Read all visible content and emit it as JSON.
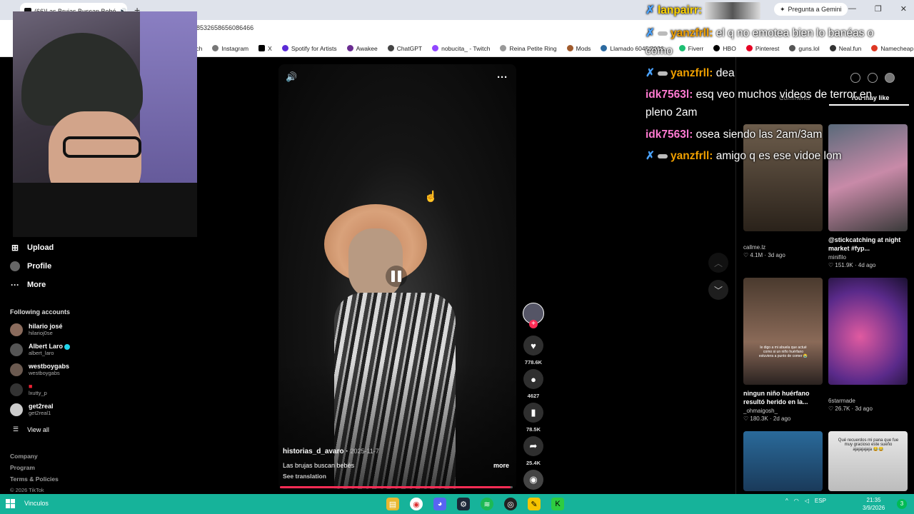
{
  "browser": {
    "tab_title": "(66)Las Brujas Buscan Bebé",
    "url_tail": "98532658656086466",
    "gemini_label": "Pregunta a Gemini",
    "bookmarks": [
      "tch",
      "Instagram",
      "X",
      "Spotify for Artists",
      "Awakee",
      "ChatGPT",
      "nobucita_ - Twitch",
      "Reina Petite Ring",
      "Mods",
      "Llamado 6045/2026...",
      "Fiverr",
      "HBO",
      "Pinterest",
      "guns.lol",
      "Neal.fun",
      "Namecheap"
    ]
  },
  "leftnav": {
    "upload": "Upload",
    "profile": "Profile",
    "more": "More",
    "following_title": "Following accounts",
    "accounts": [
      {
        "name": "hilario josé",
        "handle": "hilarioj0se"
      },
      {
        "name": "Albert Laro",
        "handle": "albert_laro"
      },
      {
        "name": "westboygabs",
        "handle": "westboygabs"
      },
      {
        "name": "",
        "handle": "lxutty_p"
      },
      {
        "name": "get2real",
        "handle": "get2real1"
      }
    ],
    "view_all": "View all",
    "footer": [
      "Company",
      "Program",
      "Terms & Policies",
      "© 2026 TikTok"
    ]
  },
  "video": {
    "author": "historias_d_avaro",
    "date": "2025-11-7",
    "caption": "Las brujas buscan bebés",
    "translate": "See translation",
    "more": "more",
    "progress": 0.99,
    "likes": "778.6K",
    "comments": "4627",
    "saves": "78.5K",
    "shares": "25.4K"
  },
  "chat": [
    {
      "user": "lanpairr",
      "text": "",
      "color": "#ffd400"
    },
    {
      "user": "yanzfrll",
      "text": "el q no emotea bien lo banéas o como",
      "color": "#f0a000"
    },
    {
      "user": "yanzfrll",
      "text": "dea",
      "color": "#f0a000"
    },
    {
      "user": "idk7563l",
      "text": "esq veo muchos videos de terror en pleno 2am",
      "color": "#ff7ad1"
    },
    {
      "user": "idk7563l",
      "text": "osea siendo las 2am/3am",
      "color": "#ff7ad1"
    },
    {
      "user": "yanzfrll",
      "text": "amigo q es ese vidoe lom",
      "color": "#f0a000"
    }
  ],
  "right_panel": {
    "tabs": [
      "Comments",
      "You may like"
    ],
    "cards": [
      {
        "title": "",
        "user": "callme.lz",
        "likes": "4.1M",
        "age": "3d ago"
      },
      {
        "title": "@stickcatching at night market #fyp...",
        "user": "minifilo",
        "likes": "151.9K",
        "age": "4d ago"
      },
      {
        "title": "ningun niño huérfano resultó herido en la...",
        "user": "_ohmaigosh_",
        "likes": "180.3K",
        "age": "2d ago"
      },
      {
        "title": "",
        "user": "6starmade",
        "likes": "26.7K",
        "age": "3d ago"
      }
    ],
    "thumb_texts": [
      "le digo a mi abuela que actué como si un niño huérfano estuviera a punto de comer 😭",
      "Qué recuerdos mi pana que fue muy gracioso este sueño ajajajajaja 😂😂"
    ]
  },
  "taskbar": {
    "label": "Vinculos",
    "lang": "ESP",
    "time": "21:35",
    "date": "3/9/2026",
    "notif_count": "3"
  },
  "colors": {
    "accent": "#fe2c55",
    "taskbar": "#16b39a"
  }
}
